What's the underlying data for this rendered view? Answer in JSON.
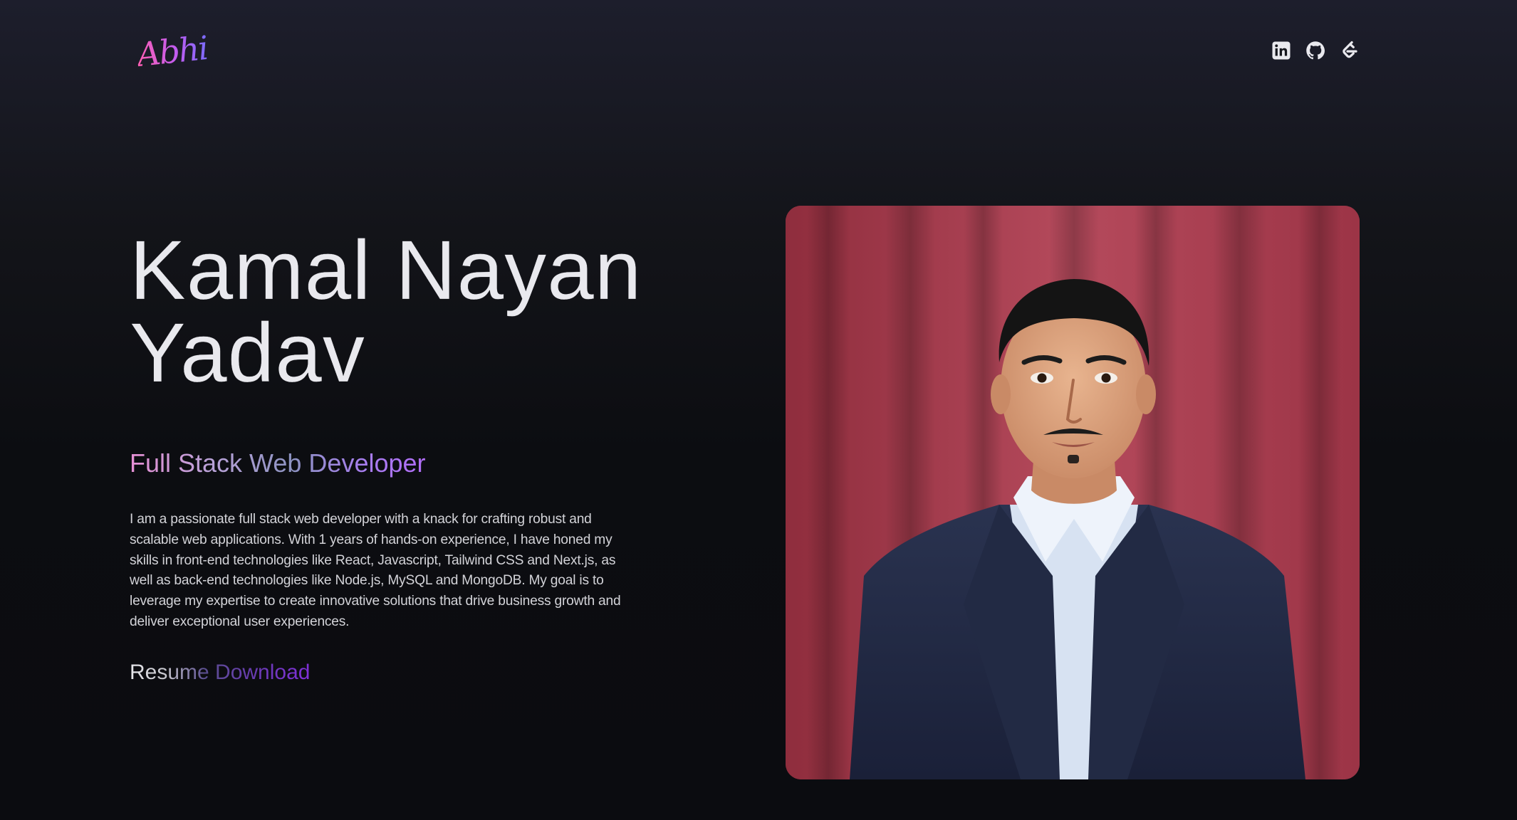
{
  "navbar": {
    "logo_text": "Abhi",
    "social_links": [
      {
        "name": "linkedin",
        "icon": "linkedin-icon"
      },
      {
        "name": "github",
        "icon": "github-icon"
      },
      {
        "name": "leetcode",
        "icon": "leetcode-icon"
      }
    ]
  },
  "hero": {
    "name_line1": "Kamal Nayan",
    "name_line2": "Yadav",
    "role": "Full Stack Web Developer",
    "bio": "I am a passionate full stack web developer with a knack for crafting robust and scalable web applications. With 1 years of hands-on experience, I have honed my skills in front-end technologies like React, Javascript, Tailwind CSS and Next.js, as well as back-end technologies like Node.js, MySQL and MongoDB. My goal is to leverage my expertise to create innovative solutions that drive business growth and deliver exceptional user experiences.",
    "resume_label": "Resume Download"
  },
  "colors": {
    "background_top": "#1d1e2c",
    "background_bottom": "#0b0c10",
    "logo_gradient_start": "#ff5fb3",
    "logo_gradient_end": "#7b6bff",
    "role_gradient_start": "#e58fd4",
    "role_gradient_end": "#b06cf7",
    "resume_accent": "#7f2fd8",
    "curtain": "#a8394d"
  }
}
